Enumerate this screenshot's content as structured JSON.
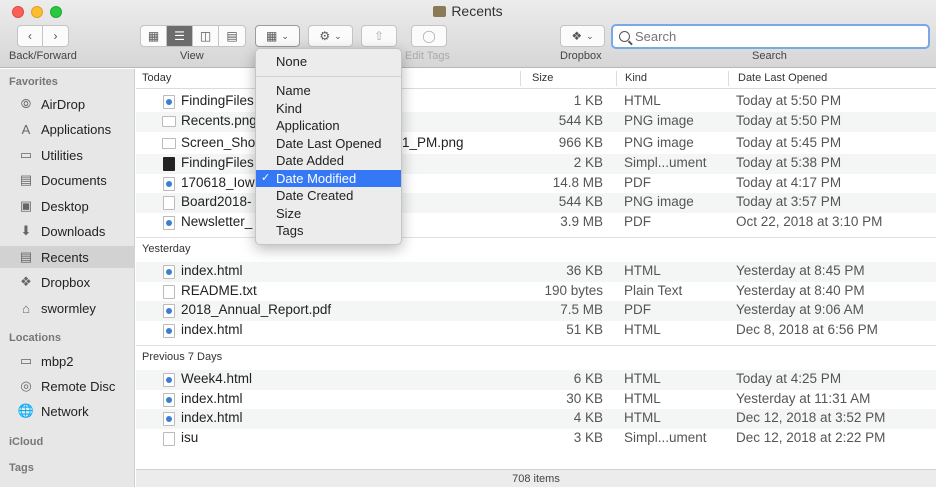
{
  "window": {
    "title": "Recents"
  },
  "toolbar": {
    "back_forward_label": "Back/Forward",
    "view_label": "View",
    "edit_tags_label": "Edit Tags",
    "dropbox_label": "Dropbox",
    "search_label": "Search",
    "search_placeholder": "Search"
  },
  "sidebar": {
    "favorites_header": "Favorites",
    "favorites": [
      {
        "label": "AirDrop",
        "icon": "airdrop-icon"
      },
      {
        "label": "Applications",
        "icon": "applications-icon"
      },
      {
        "label": "Utilities",
        "icon": "folder-icon"
      },
      {
        "label": "Documents",
        "icon": "documents-icon"
      },
      {
        "label": "Desktop",
        "icon": "desktop-icon"
      },
      {
        "label": "Downloads",
        "icon": "downloads-icon"
      },
      {
        "label": "Recents",
        "icon": "recents-icon",
        "active": true
      },
      {
        "label": "Dropbox",
        "icon": "dropbox-icon"
      },
      {
        "label": "swormley",
        "icon": "home-icon"
      }
    ],
    "locations_header": "Locations",
    "locations": [
      {
        "label": "mbp2",
        "icon": "laptop-icon"
      },
      {
        "label": "Remote Disc",
        "icon": "disc-icon"
      },
      {
        "label": "Network",
        "icon": "network-icon"
      }
    ],
    "icloud_header": "iCloud",
    "tags_header": "Tags"
  },
  "columns": {
    "name": "Today",
    "size": "Size",
    "kind": "Kind",
    "date": "Date Last Opened"
  },
  "groups": [
    {
      "header": "Today",
      "rows": [
        {
          "name": "FindingFiles",
          "size": "1 KB",
          "kind": "HTML",
          "date": "Today at 5:50 PM",
          "icon": "html"
        },
        {
          "name": "Recents.png",
          "size": "544 KB",
          "kind": "PNG image",
          "date": "Today at 5:50 PM",
          "icon": "img"
        },
        {
          "name": "Screen_Sho",
          "name_suffix": "1_PM.png",
          "size": "966 KB",
          "kind": "PNG image",
          "date": "Today at 5:45 PM",
          "icon": "img"
        },
        {
          "name": "FindingFiles",
          "size": "2 KB",
          "kind": "Simpl...ument",
          "date": "Today at 5:38 PM",
          "icon": "dark"
        },
        {
          "name": "170618_Iowa",
          "size": "14.8 MB",
          "kind": "PDF",
          "date": "Today at 4:17 PM",
          "icon": "html"
        },
        {
          "name": "Board2018-",
          "size": "544 KB",
          "kind": "PNG image",
          "date": "Today at 3:57 PM",
          "icon": "plain"
        },
        {
          "name": "Newsletter_",
          "size": "3.9 MB",
          "kind": "PDF",
          "date": "Oct 22, 2018 at 3:10 PM",
          "icon": "html"
        }
      ]
    },
    {
      "header": "Yesterday",
      "rows": [
        {
          "name": "index.html",
          "size": "36 KB",
          "kind": "HTML",
          "date": "Yesterday at 8:45 PM",
          "icon": "html"
        },
        {
          "name": "README.txt",
          "size": "190 bytes",
          "kind": "Plain Text",
          "date": "Yesterday at 8:40 PM",
          "icon": "plain"
        },
        {
          "name": "2018_Annual_Report.pdf",
          "size": "7.5 MB",
          "kind": "PDF",
          "date": "Yesterday at 9:06 AM",
          "icon": "html"
        },
        {
          "name": "index.html",
          "size": "51 KB",
          "kind": "HTML",
          "date": "Dec 8, 2018 at 6:56 PM",
          "icon": "html"
        }
      ]
    },
    {
      "header": "Previous 7 Days",
      "rows": [
        {
          "name": "Week4.html",
          "size": "6 KB",
          "kind": "HTML",
          "date": "Today at 4:25 PM",
          "icon": "html"
        },
        {
          "name": "index.html",
          "size": "30 KB",
          "kind": "HTML",
          "date": "Yesterday at 11:31 AM",
          "icon": "html"
        },
        {
          "name": "index.html",
          "size": "4 KB",
          "kind": "HTML",
          "date": "Dec 12, 2018 at 3:52 PM",
          "icon": "html"
        },
        {
          "name": "isu",
          "size": "3 KB",
          "kind": "Simpl...ument",
          "date": "Dec 12, 2018 at 2:22 PM",
          "icon": "plain"
        }
      ]
    }
  ],
  "status": {
    "count": "708 items"
  },
  "sort_menu": {
    "none": "None",
    "items": [
      "Name",
      "Kind",
      "Application",
      "Date Last Opened",
      "Date Added",
      "Date Modified",
      "Date Created",
      "Size",
      "Tags"
    ],
    "selected": "Date Modified",
    "check": "✓"
  },
  "colors": {
    "accent": "#3478f6",
    "search_focus": "#78a8e8",
    "sidebar_bg": "#e7e7e7"
  }
}
